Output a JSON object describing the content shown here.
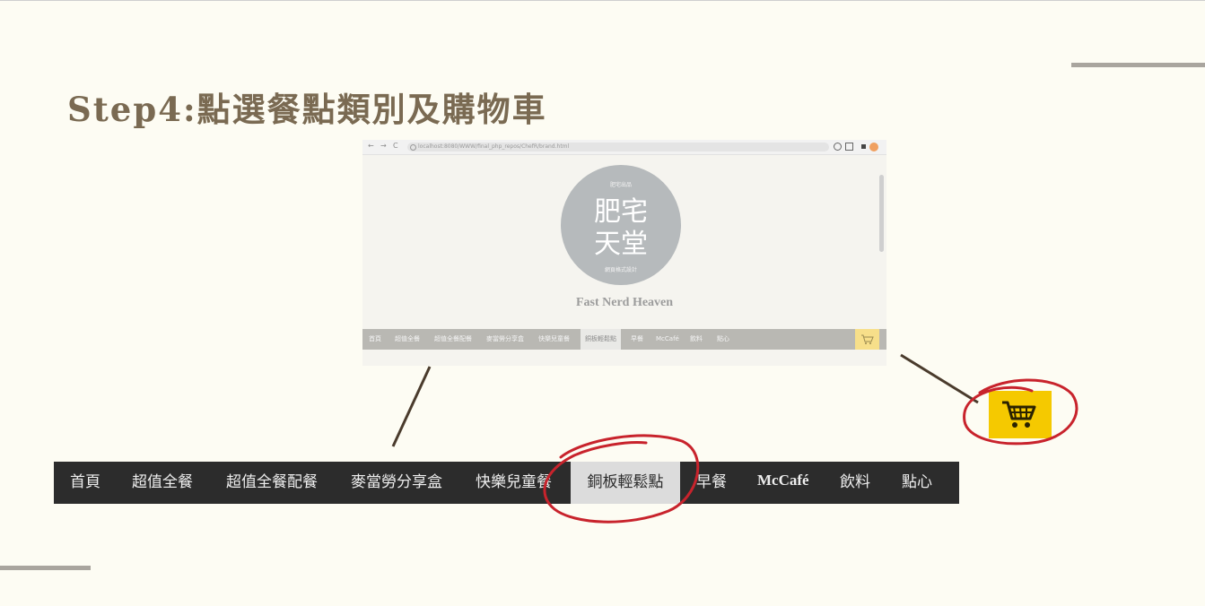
{
  "slide": {
    "title": "Step4:點選餐點類別及購物車"
  },
  "screenshot": {
    "browser": {
      "back": "←",
      "forward": "→",
      "reload": "C",
      "url": "localhost:8080/WWW/final_php_repos/ChefR/brand.html"
    },
    "logo": {
      "small_top": "肥宅出品",
      "big_line1": "肥宅",
      "big_line2": "天堂",
      "small_bottom": "網頁格式設計"
    },
    "brand_name": "Fast Nerd Heaven",
    "mini_nav": [
      "首頁",
      "超值全餐",
      "超值全餐配餐",
      "麥當勞分享盒",
      "快樂兒童餐",
      "銅板輕鬆點",
      "早餐",
      "McCafé",
      "飲料",
      "點心"
    ],
    "mini_nav_active": "銅板輕鬆點"
  },
  "nav": {
    "items": [
      {
        "label": "首頁"
      },
      {
        "label": "超值全餐"
      },
      {
        "label": "超值全餐配餐"
      },
      {
        "label": "麥當勞分享盒"
      },
      {
        "label": "快樂兒童餐"
      },
      {
        "label": "銅板輕鬆點",
        "active": true
      },
      {
        "label": "早餐"
      },
      {
        "label": "McCafé"
      },
      {
        "label": "飲料"
      },
      {
        "label": "點心"
      }
    ]
  },
  "cart": {
    "icon": "shopping-cart-icon"
  },
  "colors": {
    "background": "#fdfcf3",
    "title": "#7a6a52",
    "nav_bg": "#2c2c2c",
    "nav_active_bg": "#dcdcdc",
    "cart_bg": "#f5c900",
    "highlight_circle": "#c8232c",
    "connector": "#4a3b2c"
  }
}
